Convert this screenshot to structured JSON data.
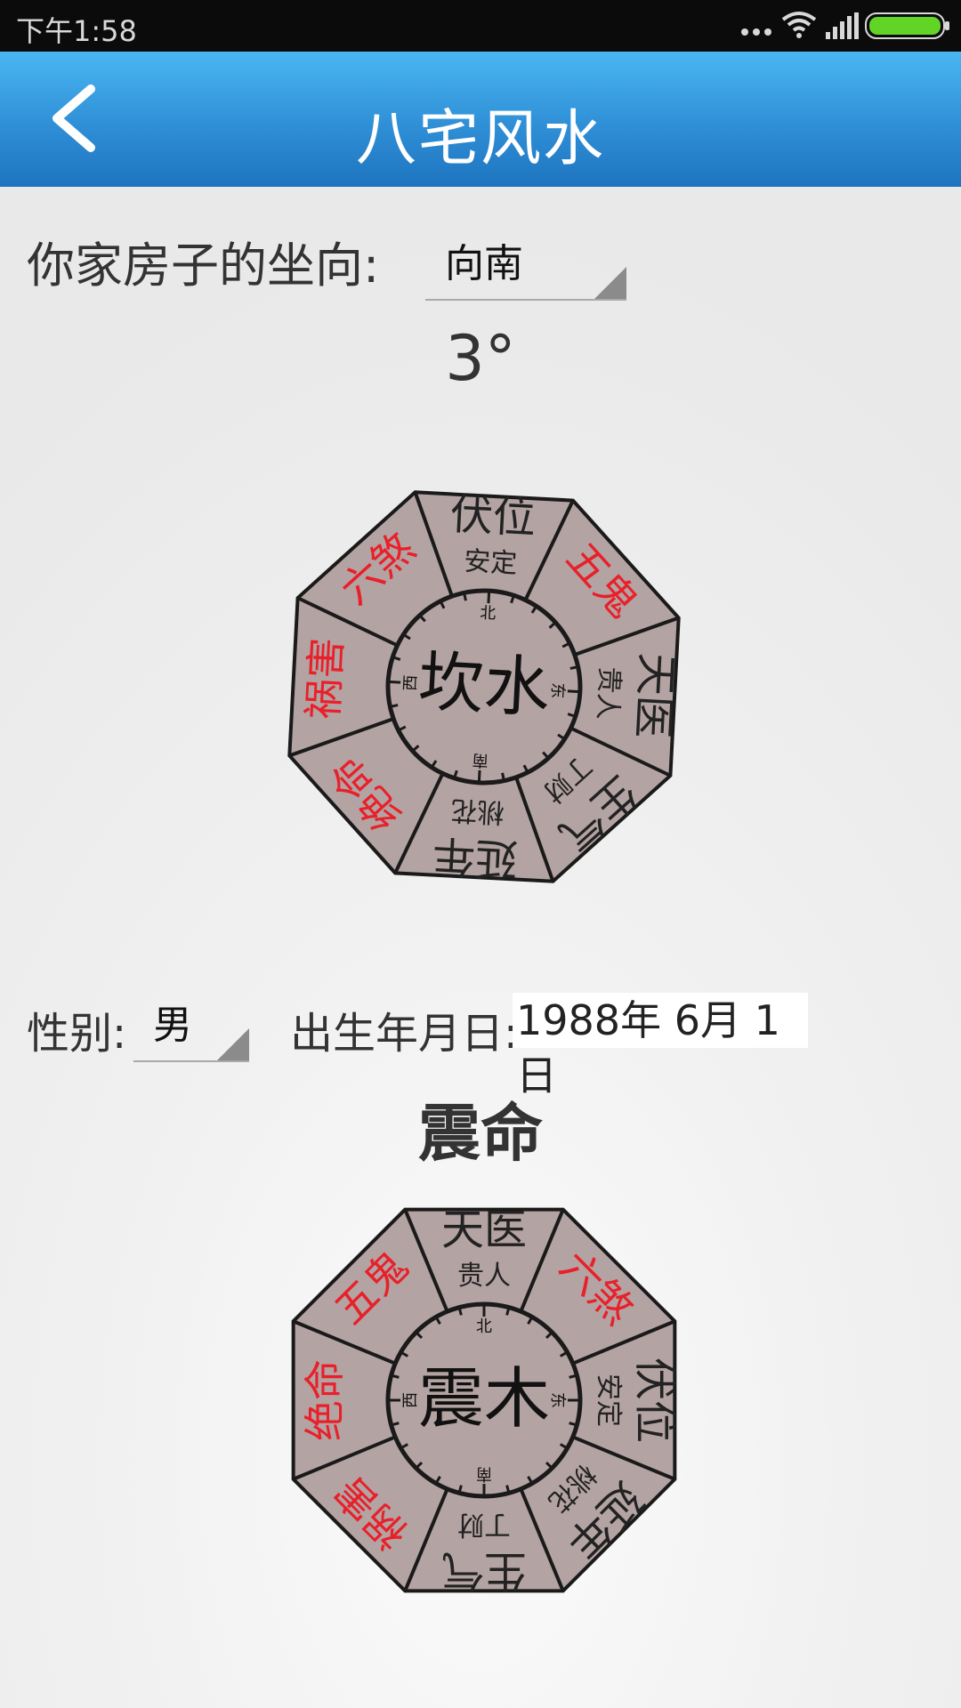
{
  "status_bar": {
    "time": "下午1:58",
    "icons": [
      "more-icon",
      "wifi-icon",
      "signal-icon",
      "battery-icon"
    ]
  },
  "app_bar": {
    "title": "八宅风水",
    "back_icon": "chevron-left-icon"
  },
  "house": {
    "label": "你家房子的坐向:",
    "orientation_value": "向南",
    "degree": "3°"
  },
  "house_compass": {
    "center": "坎水",
    "rotation_deg": 3,
    "directions": [
      "北",
      "东",
      "南",
      "西"
    ],
    "sectors": [
      {
        "name": "伏位",
        "sub": "安定",
        "color": "#222222"
      },
      {
        "name": "五鬼",
        "sub": "",
        "color": "#e8202a"
      },
      {
        "name": "天医",
        "sub": "贵人",
        "color": "#222222"
      },
      {
        "name": "生气",
        "sub": "丁财",
        "color": "#222222"
      },
      {
        "name": "延年",
        "sub": "桃花",
        "color": "#222222"
      },
      {
        "name": "绝命",
        "sub": "",
        "color": "#e8202a"
      },
      {
        "name": "祸害",
        "sub": "",
        "color": "#e8202a"
      },
      {
        "name": "六煞",
        "sub": "",
        "color": "#e8202a"
      }
    ]
  },
  "person": {
    "gender_label": "性别:",
    "gender_value": "男",
    "birth_label": "出生年月日:",
    "birth_value": "1988年 6月 1日",
    "ming": "震命"
  },
  "person_compass": {
    "center": "震木",
    "rotation_deg": 0,
    "directions": [
      "北",
      "东",
      "南",
      "西"
    ],
    "sectors": [
      {
        "name": "天医",
        "sub": "贵人",
        "color": "#222222"
      },
      {
        "name": "六煞",
        "sub": "",
        "color": "#e8202a"
      },
      {
        "name": "伏位",
        "sub": "安定",
        "color": "#222222"
      },
      {
        "name": "延年",
        "sub": "桃花",
        "color": "#222222"
      },
      {
        "name": "生气",
        "sub": "丁财",
        "color": "#222222"
      },
      {
        "name": "祸害",
        "sub": "",
        "color": "#e8202a"
      },
      {
        "name": "绝命",
        "sub": "",
        "color": "#e8202a"
      },
      {
        "name": "五鬼",
        "sub": "",
        "color": "#e8202a"
      }
    ]
  },
  "colors": {
    "compass_fill": "#b4a3a3",
    "compass_stroke": "#1a1a1a",
    "accent": "#2f8fd6"
  }
}
